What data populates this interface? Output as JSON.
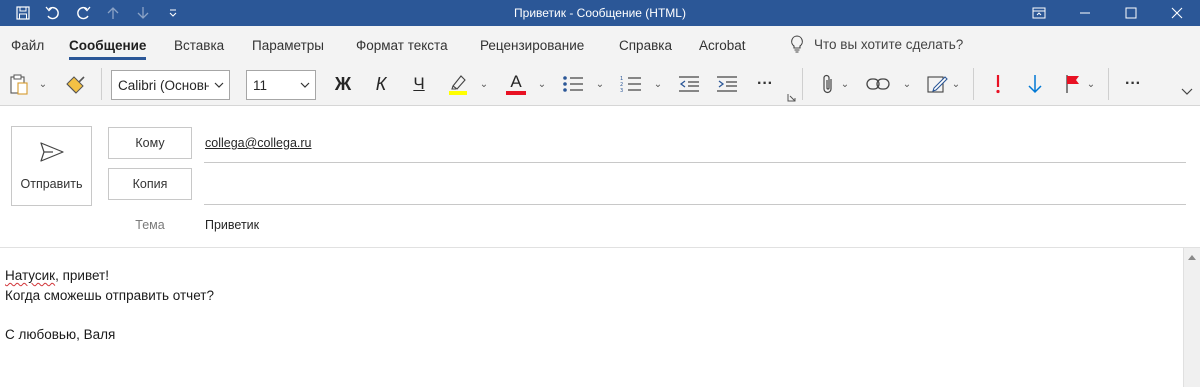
{
  "window": {
    "title": "Приветик  -  Сообщение (HTML)"
  },
  "menu": {
    "tabs": [
      "Файл",
      "Сообщение",
      "Вставка",
      "Параметры",
      "Формат текста",
      "Рецензирование",
      "Справка",
      "Acrobat"
    ],
    "active_tab": "Сообщение",
    "tell_me": "Что вы хотите сделать?"
  },
  "ribbon": {
    "font_name": "Calibri (Основн",
    "font_size": "11",
    "bold": "Ж",
    "italic": "К",
    "underline": "Ч",
    "font_color_letter": "A",
    "more": "···",
    "highlight_color": "#ffff00",
    "font_color": "#e81123",
    "importance_high_color": "#e81123",
    "importance_low_color": "#0078d4"
  },
  "compose": {
    "send_label": "Отправить",
    "to_label": "Кому",
    "cc_label": "Копия",
    "subject_label": "Тема",
    "to_value": "collega@collega.ru",
    "cc_value": "",
    "subject_value": "Приветик"
  },
  "message": {
    "greeting_name": "Натусик",
    "greeting_rest": ", привет!",
    "line2": "Когда сможешь отправить отчет?",
    "signature": "С любовью, Валя"
  },
  "colors": {
    "titlebar": "#2b5797",
    "accent": "#2b5797"
  }
}
